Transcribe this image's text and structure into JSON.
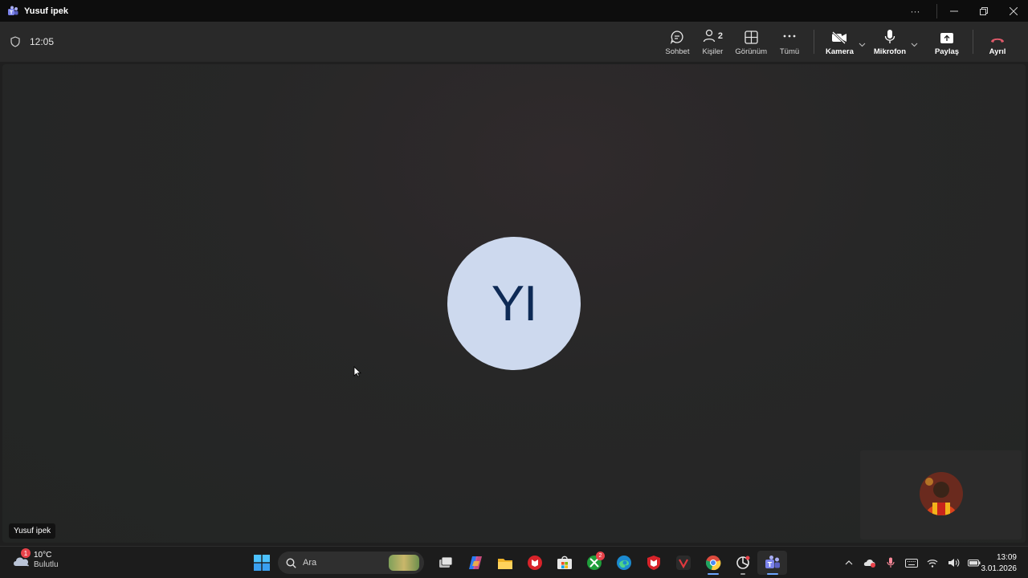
{
  "window": {
    "title": "Yusuf ipek"
  },
  "meeting": {
    "timer": "12:05",
    "toolbar": {
      "chat_label": "Sohbet",
      "people_label": "Kişiler",
      "people_count": "2",
      "view_label": "Görünüm",
      "more_label": "Tümü",
      "camera_label": "Kamera",
      "mic_label": "Mikrofon",
      "share_label": "Paylaş",
      "leave_label": "Ayrıl"
    },
    "participant": {
      "initials": "YI",
      "name": "Yusuf ipek",
      "avatar_bg": "#cdd9ee",
      "initials_color": "#0e2a55"
    },
    "leave_color": "#e05a6a"
  },
  "taskbar": {
    "weather": {
      "temp": "10°C",
      "condition": "Bulutlu",
      "badge": "1"
    },
    "search_placeholder": "Ara",
    "xbox_badge": "2",
    "clock": {
      "time": "13:09",
      "date": "3.01.2026"
    },
    "apps": [
      "start-icon",
      "task-view-icon",
      "copilot-icon",
      "file-explorer-icon",
      "mcafee-app-icon",
      "microsoft-store-icon",
      "xbox-icon",
      "edge-icon",
      "mcafee-icon",
      "vivaldi-icon",
      "chrome-icon",
      "chatgpt-icon",
      "teams-icon"
    ]
  }
}
